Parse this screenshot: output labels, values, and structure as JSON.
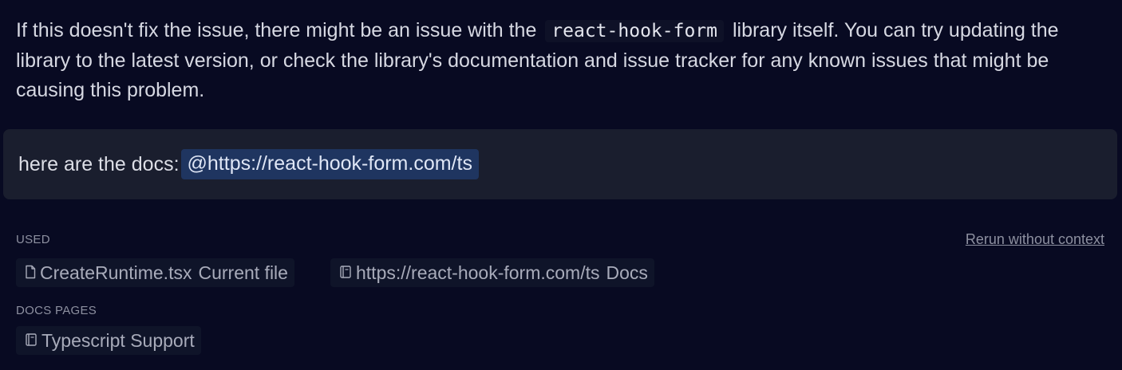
{
  "answer": {
    "text_before": "If this doesn't fix the issue, there might be an issue with the",
    "code": "react-hook-form",
    "text_after": "library itself. You can try updating the library to the latest version, or check the library's documentation and issue tracker for any known issues that might be causing this problem."
  },
  "user_message": {
    "text": "here are the docs:",
    "mention": "@https://react-hook-form.com/ts"
  },
  "context": {
    "used_label": "USED",
    "rerun_label": "Rerun without context",
    "used_items": [
      {
        "label": "CreateRuntime.tsx",
        "tag": "Current file",
        "icon": "file-icon"
      },
      {
        "label": "https://react-hook-form.com/ts",
        "tag": "Docs",
        "icon": "book-icon"
      }
    ],
    "docs_pages_label": "DOCS PAGES",
    "docs_pages": [
      {
        "label": "Typescript Support",
        "icon": "book-icon"
      }
    ]
  }
}
